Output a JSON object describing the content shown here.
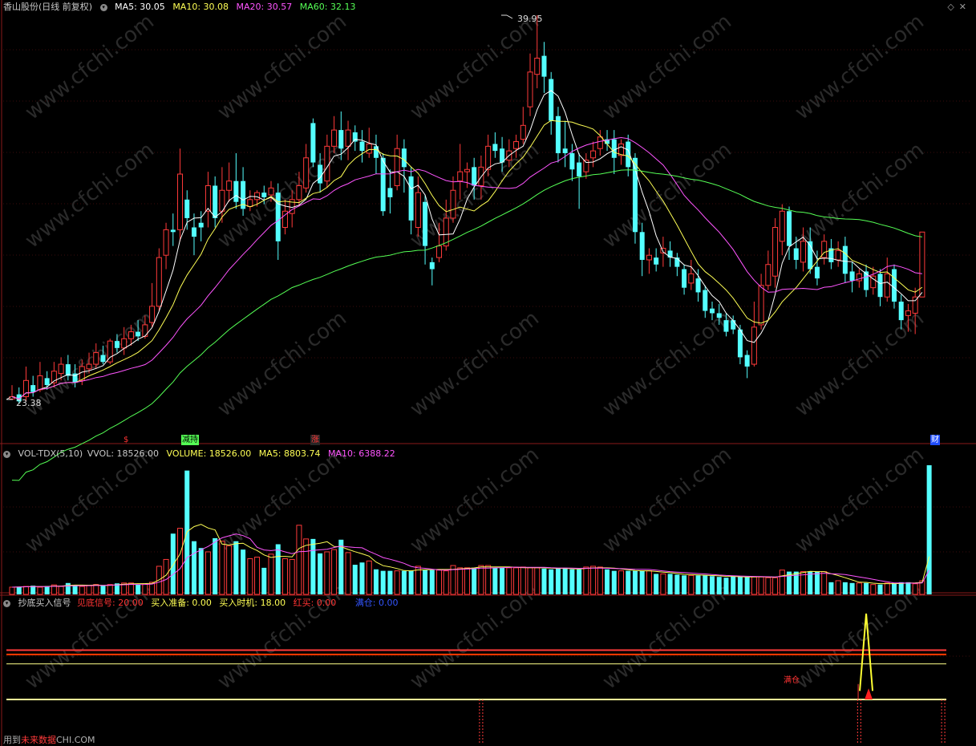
{
  "main_header": {
    "title": "香山股份(日线 前复权)",
    "items": [
      {
        "label": "MA5: 30.05",
        "color": "#ffffff"
      },
      {
        "label": "MA10: 30.08",
        "color": "#ffff55"
      },
      {
        "label": "MA20: 30.57",
        "color": "#ff55ff"
      },
      {
        "label": "MA60: 32.13",
        "color": "#55ff55"
      }
    ]
  },
  "window_icons": [
    "diamond-icon",
    "close-icon"
  ],
  "annotations": {
    "high": "39.95",
    "low": "23.38"
  },
  "events": [
    {
      "label": "$",
      "color": "#ff3333",
      "bg": "#000"
    },
    {
      "label": "减持",
      "color": "#000",
      "bg": "#55ff55"
    },
    {
      "label": "涨",
      "color": "#ff3333",
      "bg": "#202020"
    },
    {
      "label": "财",
      "color": "#ffffff",
      "bg": "#1e4cff"
    }
  ],
  "vol_header": {
    "title": "VOL-TDX(5,10)",
    "items": [
      {
        "label": "VVOL: 18526.00",
        "color": "#c0c0c0"
      },
      {
        "label": "VOLUME: 18526.00",
        "color": "#ffff55"
      },
      {
        "label": "MA5: 8803.74",
        "color": "#ffff55"
      },
      {
        "label": "MA10: 6388.22",
        "color": "#ff55ff"
      }
    ]
  },
  "ind_header": {
    "title": "抄底买入信号",
    "items": [
      {
        "label": "见底信号: 20.00",
        "color": "#ff3333"
      },
      {
        "label": "买入准备: 0.00",
        "color": "#ffff55"
      },
      {
        "label": "买入时机: 18.00",
        "color": "#ffff55"
      },
      {
        "label": "红买: 0.00",
        "color": "#ff3333"
      },
      {
        "label": "满仓: 0.00",
        "color": "#3355ff"
      }
    ]
  },
  "signal_label": "满仓",
  "footer": {
    "prefix": "用到",
    "accent": "未来数据",
    "suffix": "CHI.COM"
  },
  "watermark": "www.cfchi.com",
  "colors": {
    "up": "#ff3a3a",
    "down": "#54ffff",
    "ma5": "#ffffff",
    "ma10": "#ffff55",
    "ma20": "#ff55ff",
    "ma60": "#55ff55"
  },
  "chart_data": {
    "type": "candlestick",
    "high_label": 39.95,
    "low_label": 23.38,
    "candles": [
      {
        "o": 23.4,
        "c": 23.5,
        "h": 24.0,
        "l": 23.38
      },
      {
        "o": 23.6,
        "c": 23.3,
        "h": 23.9,
        "l": 23.2
      },
      {
        "o": 23.5,
        "c": 24.2,
        "h": 24.8,
        "l": 23.3
      },
      {
        "o": 24.0,
        "c": 23.7,
        "h": 24.4,
        "l": 23.5
      },
      {
        "o": 23.8,
        "c": 24.4,
        "h": 25.0,
        "l": 23.7
      },
      {
        "o": 24.3,
        "c": 24.0,
        "h": 24.6,
        "l": 23.8
      },
      {
        "o": 24.1,
        "c": 24.6,
        "h": 25.0,
        "l": 23.9
      },
      {
        "o": 24.5,
        "c": 24.9,
        "h": 25.2,
        "l": 24.2
      },
      {
        "o": 24.9,
        "c": 24.4,
        "h": 25.3,
        "l": 24.2
      },
      {
        "o": 24.5,
        "c": 24.1,
        "h": 24.9,
        "l": 23.9
      },
      {
        "o": 24.2,
        "c": 24.8,
        "h": 25.1,
        "l": 24.0
      },
      {
        "o": 24.7,
        "c": 24.9,
        "h": 25.4,
        "l": 24.5
      },
      {
        "o": 24.9,
        "c": 25.4,
        "h": 25.8,
        "l": 24.7
      },
      {
        "o": 25.3,
        "c": 25.0,
        "h": 25.7,
        "l": 24.9
      },
      {
        "o": 25.0,
        "c": 25.9,
        "h": 26.0,
        "l": 24.9
      },
      {
        "o": 25.9,
        "c": 25.6,
        "h": 26.2,
        "l": 25.4
      },
      {
        "o": 25.6,
        "c": 26.0,
        "h": 26.5,
        "l": 25.3
      },
      {
        "o": 26.0,
        "c": 26.3,
        "h": 26.6,
        "l": 25.7
      },
      {
        "o": 26.3,
        "c": 26.1,
        "h": 26.8,
        "l": 25.9
      },
      {
        "o": 26.1,
        "c": 26.6,
        "h": 27.0,
        "l": 26.0
      },
      {
        "o": 26.7,
        "c": 27.4,
        "h": 28.4,
        "l": 26.5
      },
      {
        "o": 27.4,
        "c": 29.5,
        "h": 29.9,
        "l": 27.2
      },
      {
        "o": 29.6,
        "c": 30.7,
        "h": 31.0,
        "l": 29.0
      },
      {
        "o": 30.7,
        "c": 30.6,
        "h": 31.4,
        "l": 30.0
      },
      {
        "o": 30.7,
        "c": 33.1,
        "h": 34.2,
        "l": 30.2
      },
      {
        "o": 32.0,
        "c": 31.2,
        "h": 32.4,
        "l": 30.7
      },
      {
        "o": 30.8,
        "c": 30.4,
        "h": 31.4,
        "l": 29.6
      },
      {
        "o": 31.0,
        "c": 30.8,
        "h": 31.5,
        "l": 30.2
      },
      {
        "o": 31.5,
        "c": 32.6,
        "h": 33.2,
        "l": 30.8
      },
      {
        "o": 32.6,
        "c": 31.2,
        "h": 33.0,
        "l": 30.8
      },
      {
        "o": 31.5,
        "c": 32.4,
        "h": 33.4,
        "l": 31.0
      },
      {
        "o": 32.4,
        "c": 32.8,
        "h": 33.6,
        "l": 31.9
      },
      {
        "o": 32.8,
        "c": 31.9,
        "h": 34.0,
        "l": 31.6
      },
      {
        "o": 32.8,
        "c": 31.6,
        "h": 33.4,
        "l": 31.3
      },
      {
        "o": 31.7,
        "c": 32.0,
        "h": 32.4,
        "l": 31.5
      },
      {
        "o": 32.0,
        "c": 32.3,
        "h": 32.4,
        "l": 31.7
      },
      {
        "o": 32.3,
        "c": 32.1,
        "h": 32.6,
        "l": 31.8
      },
      {
        "o": 32.2,
        "c": 32.5,
        "h": 32.8,
        "l": 31.9
      },
      {
        "o": 32.3,
        "c": 30.2,
        "h": 32.7,
        "l": 29.4
      },
      {
        "o": 30.8,
        "c": 31.5,
        "h": 32.0,
        "l": 30.5
      },
      {
        "o": 31.4,
        "c": 32.0,
        "h": 32.4,
        "l": 30.8
      },
      {
        "o": 32.0,
        "c": 32.6,
        "h": 33.2,
        "l": 31.7
      },
      {
        "o": 32.5,
        "c": 33.8,
        "h": 34.4,
        "l": 32.3
      },
      {
        "o": 35.3,
        "c": 33.6,
        "h": 35.5,
        "l": 33.4
      },
      {
        "o": 33.5,
        "c": 32.7,
        "h": 34.0,
        "l": 32.3
      },
      {
        "o": 32.8,
        "c": 34.3,
        "h": 34.8,
        "l": 32.5
      },
      {
        "o": 34.3,
        "c": 35.0,
        "h": 35.6,
        "l": 34.0
      },
      {
        "o": 35.0,
        "c": 34.2,
        "h": 35.8,
        "l": 33.7
      },
      {
        "o": 34.3,
        "c": 35.0,
        "h": 35.4,
        "l": 33.7
      },
      {
        "o": 34.9,
        "c": 34.5,
        "h": 35.2,
        "l": 34.1
      },
      {
        "o": 34.5,
        "c": 34.1,
        "h": 35.0,
        "l": 33.6
      },
      {
        "o": 34.0,
        "c": 34.4,
        "h": 35.1,
        "l": 33.8
      },
      {
        "o": 34.3,
        "c": 33.8,
        "h": 34.8,
        "l": 33.1
      },
      {
        "o": 33.8,
        "c": 31.5,
        "h": 34.0,
        "l": 31.3
      },
      {
        "o": 32.5,
        "c": 32.1,
        "h": 33.3,
        "l": 31.4
      },
      {
        "o": 32.6,
        "c": 34.2,
        "h": 34.8,
        "l": 32.4
      },
      {
        "o": 34.2,
        "c": 33.4,
        "h": 34.6,
        "l": 32.3
      },
      {
        "o": 33.0,
        "c": 31.1,
        "h": 33.4,
        "l": 30.5
      },
      {
        "o": 30.8,
        "c": 32.3,
        "h": 33.0,
        "l": 30.4
      },
      {
        "o": 31.9,
        "c": 30.0,
        "h": 32.2,
        "l": 29.2
      },
      {
        "o": 29.3,
        "c": 29.0,
        "h": 29.5,
        "l": 28.3
      },
      {
        "o": 29.5,
        "c": 30.0,
        "h": 31.0,
        "l": 29.3
      },
      {
        "o": 30.0,
        "c": 31.2,
        "h": 32.0,
        "l": 29.8
      },
      {
        "o": 31.2,
        "c": 32.4,
        "h": 33.0,
        "l": 31.0
      },
      {
        "o": 32.8,
        "c": 33.2,
        "h": 34.4,
        "l": 32.0
      },
      {
        "o": 33.2,
        "c": 33.3,
        "h": 33.6,
        "l": 32.5
      },
      {
        "o": 33.4,
        "c": 32.6,
        "h": 33.8,
        "l": 32.0
      },
      {
        "o": 32.6,
        "c": 33.4,
        "h": 33.9,
        "l": 32.0
      },
      {
        "o": 33.3,
        "c": 34.3,
        "h": 34.8,
        "l": 33.0
      },
      {
        "o": 34.4,
        "c": 34.1,
        "h": 34.9,
        "l": 33.8
      },
      {
        "o": 34.2,
        "c": 33.6,
        "h": 34.7,
        "l": 33.2
      },
      {
        "o": 33.7,
        "c": 34.1,
        "h": 34.6,
        "l": 33.4
      },
      {
        "o": 34.2,
        "c": 34.5,
        "h": 34.8,
        "l": 33.8
      },
      {
        "o": 34.6,
        "c": 35.2,
        "h": 36.0,
        "l": 34.4
      },
      {
        "o": 36.0,
        "c": 37.5,
        "h": 38.3,
        "l": 35.6
      },
      {
        "o": 37.4,
        "c": 38.1,
        "h": 39.95,
        "l": 36.8
      },
      {
        "o": 38.2,
        "c": 37.3,
        "h": 38.8,
        "l": 36.6
      },
      {
        "o": 37.2,
        "c": 35.4,
        "h": 37.5,
        "l": 34.8
      },
      {
        "o": 35.6,
        "c": 34.0,
        "h": 36.0,
        "l": 33.6
      },
      {
        "o": 34.2,
        "c": 34.0,
        "h": 35.4,
        "l": 33.4
      },
      {
        "o": 34.0,
        "c": 33.3,
        "h": 34.4,
        "l": 32.8
      },
      {
        "o": 33.6,
        "c": 33.0,
        "h": 34.0,
        "l": 31.6
      },
      {
        "o": 33.2,
        "c": 33.7,
        "h": 34.0,
        "l": 32.9
      },
      {
        "o": 33.8,
        "c": 34.1,
        "h": 34.5,
        "l": 33.4
      },
      {
        "o": 34.2,
        "c": 34.7,
        "h": 35.0,
        "l": 33.9
      },
      {
        "o": 34.6,
        "c": 34.4,
        "h": 35.0,
        "l": 34.1
      },
      {
        "o": 34.6,
        "c": 33.8,
        "h": 35.0,
        "l": 33.1
      },
      {
        "o": 33.9,
        "c": 34.4,
        "h": 34.6,
        "l": 33.5
      },
      {
        "o": 34.5,
        "c": 33.4,
        "h": 34.8,
        "l": 33.0
      },
      {
        "o": 33.8,
        "c": 30.6,
        "h": 34.0,
        "l": 30.1
      },
      {
        "o": 30.6,
        "c": 29.4,
        "h": 31.0,
        "l": 28.7
      },
      {
        "o": 29.4,
        "c": 29.6,
        "h": 29.9,
        "l": 28.8
      },
      {
        "o": 29.5,
        "c": 29.2,
        "h": 29.9,
        "l": 28.9
      },
      {
        "o": 29.7,
        "c": 29.9,
        "h": 30.4,
        "l": 29.1
      },
      {
        "o": 29.8,
        "c": 29.5,
        "h": 30.2,
        "l": 29.1
      },
      {
        "o": 29.5,
        "c": 29.1,
        "h": 29.7,
        "l": 28.7
      },
      {
        "o": 29.0,
        "c": 28.2,
        "h": 29.2,
        "l": 27.9
      },
      {
        "o": 28.4,
        "c": 28.8,
        "h": 29.4,
        "l": 28.1
      },
      {
        "o": 28.6,
        "c": 28.0,
        "h": 29.0,
        "l": 27.6
      },
      {
        "o": 28.1,
        "c": 27.2,
        "h": 28.3,
        "l": 26.9
      },
      {
        "o": 27.3,
        "c": 27.1,
        "h": 27.6,
        "l": 26.8
      },
      {
        "o": 27.1,
        "c": 26.9,
        "h": 27.5,
        "l": 26.6
      },
      {
        "o": 26.8,
        "c": 26.3,
        "h": 27.1,
        "l": 26.1
      },
      {
        "o": 26.8,
        "c": 26.4,
        "h": 27.0,
        "l": 26.2
      },
      {
        "o": 26.4,
        "c": 25.2,
        "h": 26.6,
        "l": 24.9
      },
      {
        "o": 25.3,
        "c": 24.8,
        "h": 25.5,
        "l": 24.3
      },
      {
        "o": 24.9,
        "c": 26.5,
        "h": 27.6,
        "l": 24.8
      },
      {
        "o": 26.6,
        "c": 28.3,
        "h": 28.8,
        "l": 26.4
      },
      {
        "o": 28.3,
        "c": 29.2,
        "h": 29.8,
        "l": 28.1
      },
      {
        "o": 28.7,
        "c": 30.8,
        "h": 31.2,
        "l": 28.2
      },
      {
        "o": 30.2,
        "c": 31.5,
        "h": 31.8,
        "l": 29.6
      },
      {
        "o": 31.5,
        "c": 30.0,
        "h": 31.7,
        "l": 29.4
      },
      {
        "o": 29.9,
        "c": 29.4,
        "h": 30.4,
        "l": 29.0
      },
      {
        "o": 29.3,
        "c": 30.2,
        "h": 30.8,
        "l": 28.9
      },
      {
        "o": 30.2,
        "c": 29.0,
        "h": 30.8,
        "l": 28.8
      },
      {
        "o": 29.1,
        "c": 28.6,
        "h": 29.8,
        "l": 28.3
      },
      {
        "o": 29.5,
        "c": 30.2,
        "h": 30.5,
        "l": 29.2
      },
      {
        "o": 29.9,
        "c": 29.3,
        "h": 30.3,
        "l": 29.0
      },
      {
        "o": 29.4,
        "c": 29.8,
        "h": 30.2,
        "l": 29.1
      },
      {
        "o": 30.0,
        "c": 28.8,
        "h": 30.4,
        "l": 28.4
      },
      {
        "o": 28.9,
        "c": 28.5,
        "h": 29.3,
        "l": 28.0
      },
      {
        "o": 28.5,
        "c": 28.8,
        "h": 29.0,
        "l": 28.2
      },
      {
        "o": 28.9,
        "c": 28.1,
        "h": 29.2,
        "l": 27.8
      },
      {
        "o": 28.2,
        "c": 28.7,
        "h": 29.1,
        "l": 27.9
      },
      {
        "o": 28.8,
        "c": 27.8,
        "h": 29.0,
        "l": 27.4
      },
      {
        "o": 27.8,
        "c": 28.8,
        "h": 29.5,
        "l": 27.6
      },
      {
        "o": 29.0,
        "c": 27.6,
        "h": 29.2,
        "l": 27.3
      },
      {
        "o": 27.6,
        "c": 26.8,
        "h": 27.9,
        "l": 26.4
      },
      {
        "o": 27.0,
        "c": 27.2,
        "h": 27.5,
        "l": 26.3
      },
      {
        "o": 27.1,
        "c": 27.8,
        "h": 28.2,
        "l": 26.2
      },
      {
        "o": 27.8,
        "c": 30.6,
        "h": 30.6,
        "l": 27.8
      }
    ],
    "volume": [
      950,
      1000,
      1050,
      1150,
      950,
      1100,
      1250,
      1050,
      1500,
      1250,
      1050,
      1150,
      1300,
      1150,
      1300,
      1450,
      1500,
      1500,
      1300,
      1400,
      1600,
      3700,
      4600,
      8000,
      8700,
      16300,
      7000,
      6100,
      5600,
      7400,
      7000,
      6400,
      7000,
      5900,
      4700,
      4900,
      3500,
      5300,
      6600,
      4700,
      4600,
      9100,
      7300,
      7300,
      5400,
      5600,
      5900,
      7200,
      5500,
      3900,
      4200,
      4400,
      3300,
      3100,
      3100,
      3100,
      3100,
      3100,
      3700,
      3200,
      3200,
      3200,
      3100,
      3800,
      3500,
      3500,
      3500,
      3800,
      3800,
      3500,
      3500,
      3500,
      3500,
      3600,
      3500,
      3500,
      3400,
      3300,
      3400,
      3500,
      3300,
      3300,
      3600,
      3700,
      3600,
      3300,
      3100,
      3100,
      3100,
      3100,
      3100,
      3100,
      2700,
      2700,
      2700,
      2600,
      2500,
      2500,
      2500,
      2500,
      2400,
      2300,
      2200,
      2400,
      2300,
      2300,
      2300,
      2300,
      2200,
      2200,
      3200,
      3000,
      3000,
      3000,
      3000,
      3000,
      3000,
      1600,
      1800,
      1600,
      1500,
      1500,
      1500,
      1300,
      1300,
      1500,
      1500,
      1600,
      1600,
      1400,
      1800,
      18526
    ],
    "vol_up": [
      true,
      false,
      true,
      false,
      true,
      false,
      true,
      true,
      false,
      false,
      true,
      true,
      true,
      false,
      true,
      false,
      true,
      true,
      false,
      true,
      true,
      true,
      true,
      false,
      true,
      false,
      false,
      true,
      true,
      false,
      true,
      true,
      false,
      false,
      true,
      true,
      false,
      true,
      false,
      true,
      true,
      true,
      true,
      false,
      false,
      true,
      true,
      false,
      true,
      false,
      false,
      true,
      false,
      false,
      false,
      true,
      false,
      false,
      true,
      false,
      false,
      true,
      true,
      true,
      true,
      true,
      false,
      true,
      true,
      false,
      false,
      true,
      true,
      true,
      true,
      true,
      false,
      false,
      false,
      false,
      false,
      false,
      true,
      true,
      true,
      false,
      false,
      true,
      false,
      false,
      false,
      true,
      false,
      true,
      false,
      false,
      false,
      true,
      false,
      false,
      false,
      false,
      false,
      true,
      false,
      false,
      true,
      true,
      true,
      true,
      true,
      false,
      false,
      true,
      false,
      false,
      true,
      false,
      true,
      false,
      false,
      true,
      false,
      true,
      false,
      true,
      false,
      false,
      false,
      true,
      true
    ],
    "signal": {
      "index": 122,
      "peak": 20.0,
      "buy_timing": 18.0
    },
    "red_lines": [
      11.5,
      10.5
    ],
    "yellow_line": 0.0,
    "dashed_marks": [
      67,
      121,
      133
    ]
  }
}
